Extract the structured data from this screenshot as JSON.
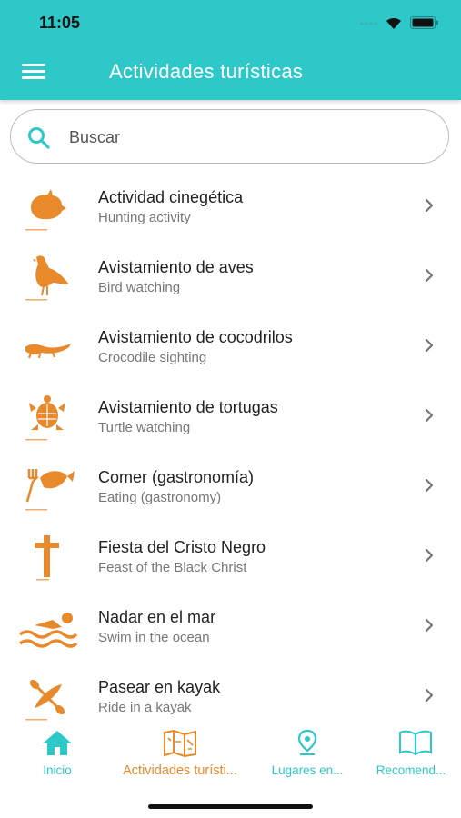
{
  "status": {
    "time": "11:05"
  },
  "header": {
    "title": "Actividades turísticas",
    "menu_icon": "hamburger-menu-icon"
  },
  "colors": {
    "accent": "#2ec8c9",
    "icon_orange": "#e8892b",
    "active_tab": "#e8892b"
  },
  "search": {
    "placeholder": "Buscar",
    "value": ""
  },
  "activities": [
    {
      "title": "Actividad cinegética",
      "subtitle": "Hunting activity",
      "icon": "boar-icon"
    },
    {
      "title": "Avistamiento de aves",
      "subtitle": "Bird watching",
      "icon": "bird-icon"
    },
    {
      "title": "Avistamiento de cocodrilos",
      "subtitle": "Crocodile sighting",
      "icon": "crocodile-icon"
    },
    {
      "title": "Avistamiento de tortugas",
      "subtitle": "Turtle watching",
      "icon": "turtle-icon"
    },
    {
      "title": "Comer (gastronomía)",
      "subtitle": "Eating (gastronomy)",
      "icon": "fish-fork-icon"
    },
    {
      "title": "Fiesta del Cristo Negro",
      "subtitle": "Feast of the Black Christ",
      "icon": "crucifix-icon"
    },
    {
      "title": "Nadar en el mar",
      "subtitle": "Swim in the ocean",
      "icon": "swimmer-icon"
    },
    {
      "title": "Pasear en kayak",
      "subtitle": "Ride in a kayak",
      "icon": "kayak-icon"
    }
  ],
  "tabs": [
    {
      "label": "Inicio",
      "icon": "home-icon",
      "active": false
    },
    {
      "label": "Actividades turísti...",
      "icon": "map-icon",
      "active": true
    },
    {
      "label": "Lugares en...",
      "icon": "location-pin-icon",
      "active": false
    },
    {
      "label": "Recomend...",
      "icon": "book-icon",
      "active": false
    }
  ]
}
